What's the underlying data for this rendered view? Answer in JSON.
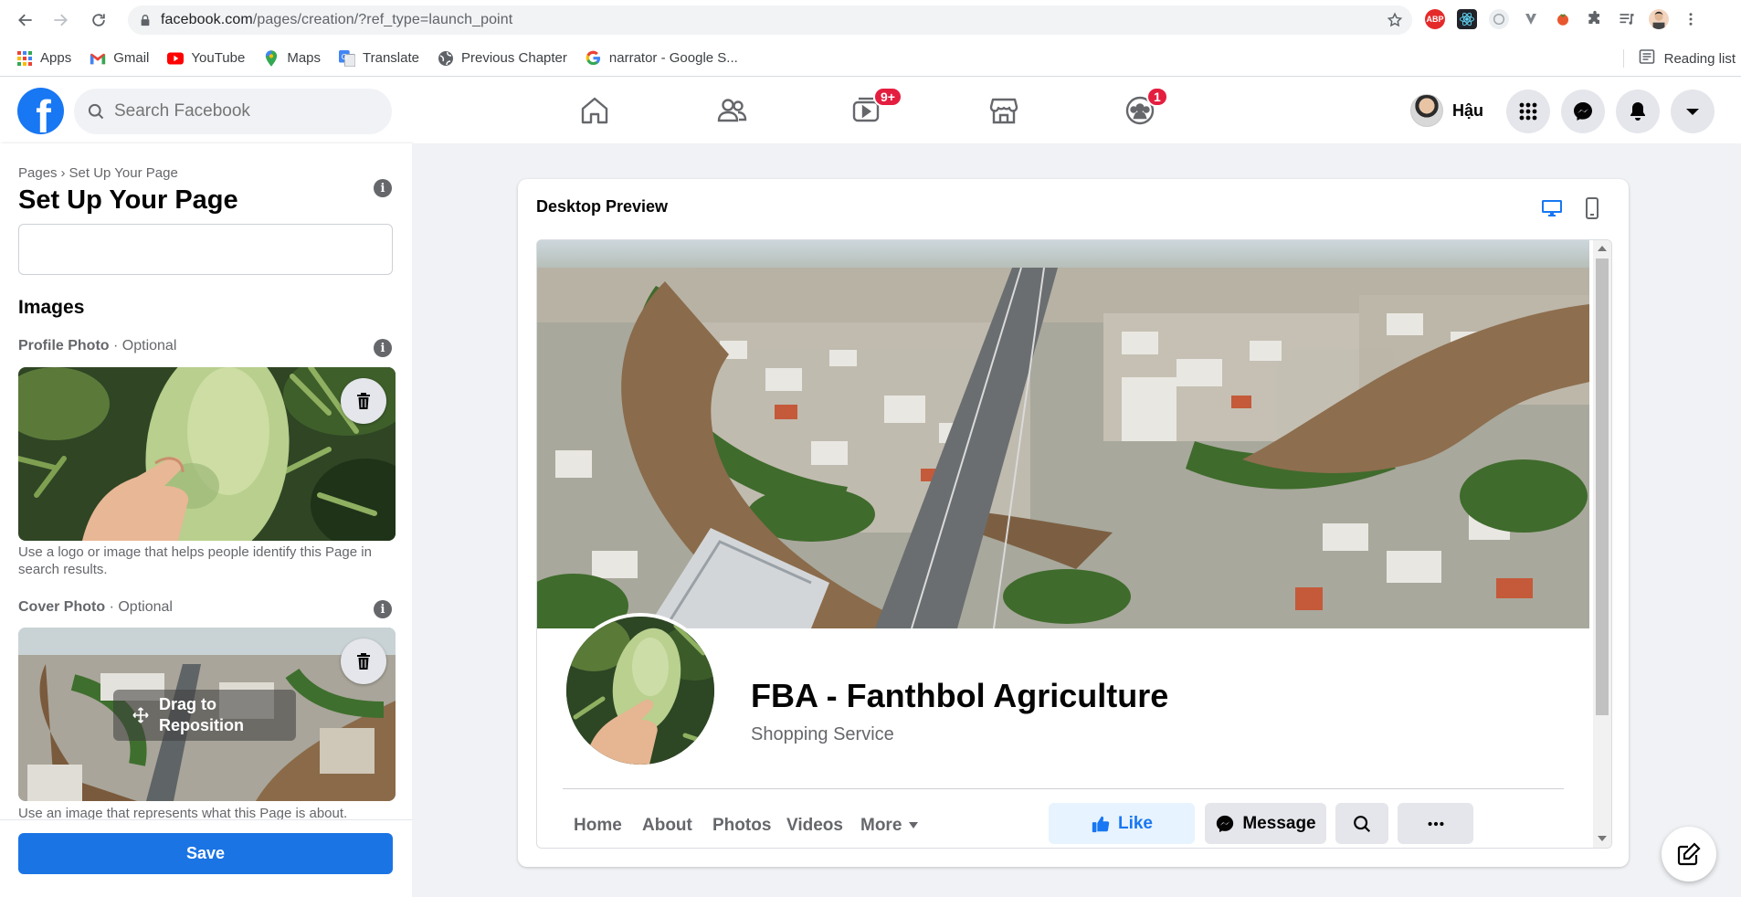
{
  "browser": {
    "url_host": "facebook.com",
    "url_path": "/pages/creation/?ref_type=launch_point",
    "bookmarks": [
      {
        "label": "Apps",
        "icon": "apps-grid-icon"
      },
      {
        "label": "Gmail",
        "icon": "gmail-icon"
      },
      {
        "label": "YouTube",
        "icon": "youtube-icon"
      },
      {
        "label": "Maps",
        "icon": "maps-pin-icon"
      },
      {
        "label": "Translate",
        "icon": "translate-icon"
      },
      {
        "label": "Previous Chapter",
        "icon": "globe-icon"
      },
      {
        "label": "narrator - Google S...",
        "icon": "google-icon"
      }
    ],
    "reading_list": "Reading list",
    "extensions": [
      "ABP",
      "react-icon",
      "ext-icon",
      "vector-icon",
      "ext-icon-2",
      "puzzle-icon",
      "media-icon"
    ]
  },
  "fb": {
    "search_placeholder": "Search Facebook",
    "watch_badge": "9+",
    "groups_badge": "1",
    "user_name": "Hậu"
  },
  "left": {
    "breadcrumb_root": "Pages",
    "breadcrumb_sep": "›",
    "breadcrumb_current": "Set Up Your Page",
    "title": "Set Up Your Page",
    "info_glyph": "i",
    "images_heading": "Images",
    "profile_label": "Profile Photo",
    "profile_optional": " · Optional",
    "profile_help": "Use a logo or image that helps people identify this Page in search results.",
    "cover_label": "Cover Photo",
    "cover_optional": " · Optional",
    "drag_line1": "Drag to",
    "drag_line2": "Reposition",
    "cover_help": "Use an image that represents what this Page is about.",
    "save": "Save"
  },
  "preview": {
    "title": "Desktop Preview",
    "page_name": "FBA - Fanthbol Agriculture",
    "category": "Shopping Service",
    "tabs": [
      "Home",
      "About",
      "Photos",
      "Videos",
      "More"
    ],
    "like": "Like",
    "message": "Message"
  }
}
